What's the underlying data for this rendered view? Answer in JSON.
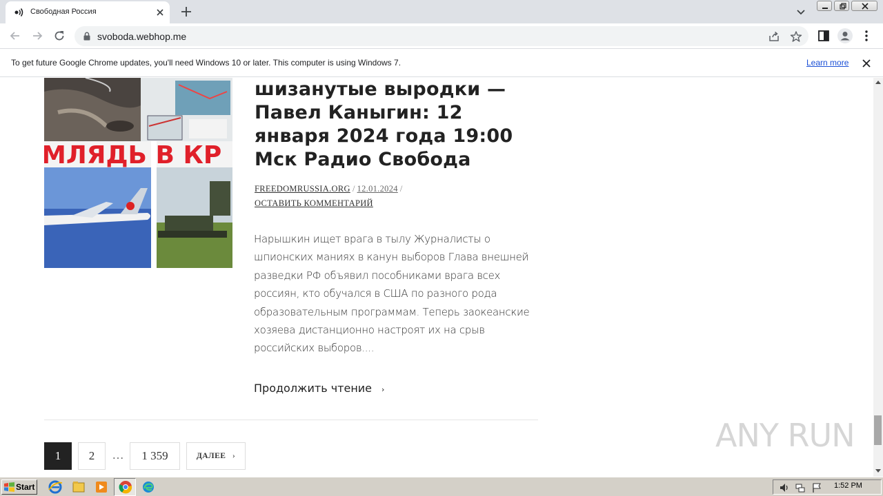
{
  "browser": {
    "tab": {
      "title": "Свободная Россия"
    },
    "address": {
      "url": "svoboda.webhop.me"
    },
    "infobar": {
      "text": "To get future Google Chrome updates, you'll need Windows 10 or later. This computer is using Windows 7.",
      "link": "Learn more"
    }
  },
  "article": {
    "image_caption_text": "МЛЯДЬ В КР",
    "title": "шизанутые выродки — Павел Каныгин: 12 января 2024 года 19:00 Мск Радио Свобода",
    "author": "FREEDOMRUSSIA.ORG",
    "separator": "/",
    "date": "12.01.2024",
    "comment_link": "ОСТАВИТЬ КОММЕНТАРИЙ",
    "excerpt": "Нарышкин ищет врага в тылу Журналисты о шпионских маниях в канун выборов Глава внешней разведки РФ объявил пособниками врага всех россиян, кто обучался в США по разного рода образовательным программам. Теперь заокеанские хозяева дистанционно настроят их на срыв российских выборов....",
    "read_more": "Продолжить чтение",
    "read_more_arrow": "›"
  },
  "pagination": {
    "current": "1",
    "page2": "2",
    "dots": "…",
    "last": "1 359",
    "next": "ДАЛЕЕ",
    "next_arrow": "›"
  },
  "watermark": "ANY RUN",
  "taskbar": {
    "start": "Start",
    "clock": "1:52 PM"
  }
}
